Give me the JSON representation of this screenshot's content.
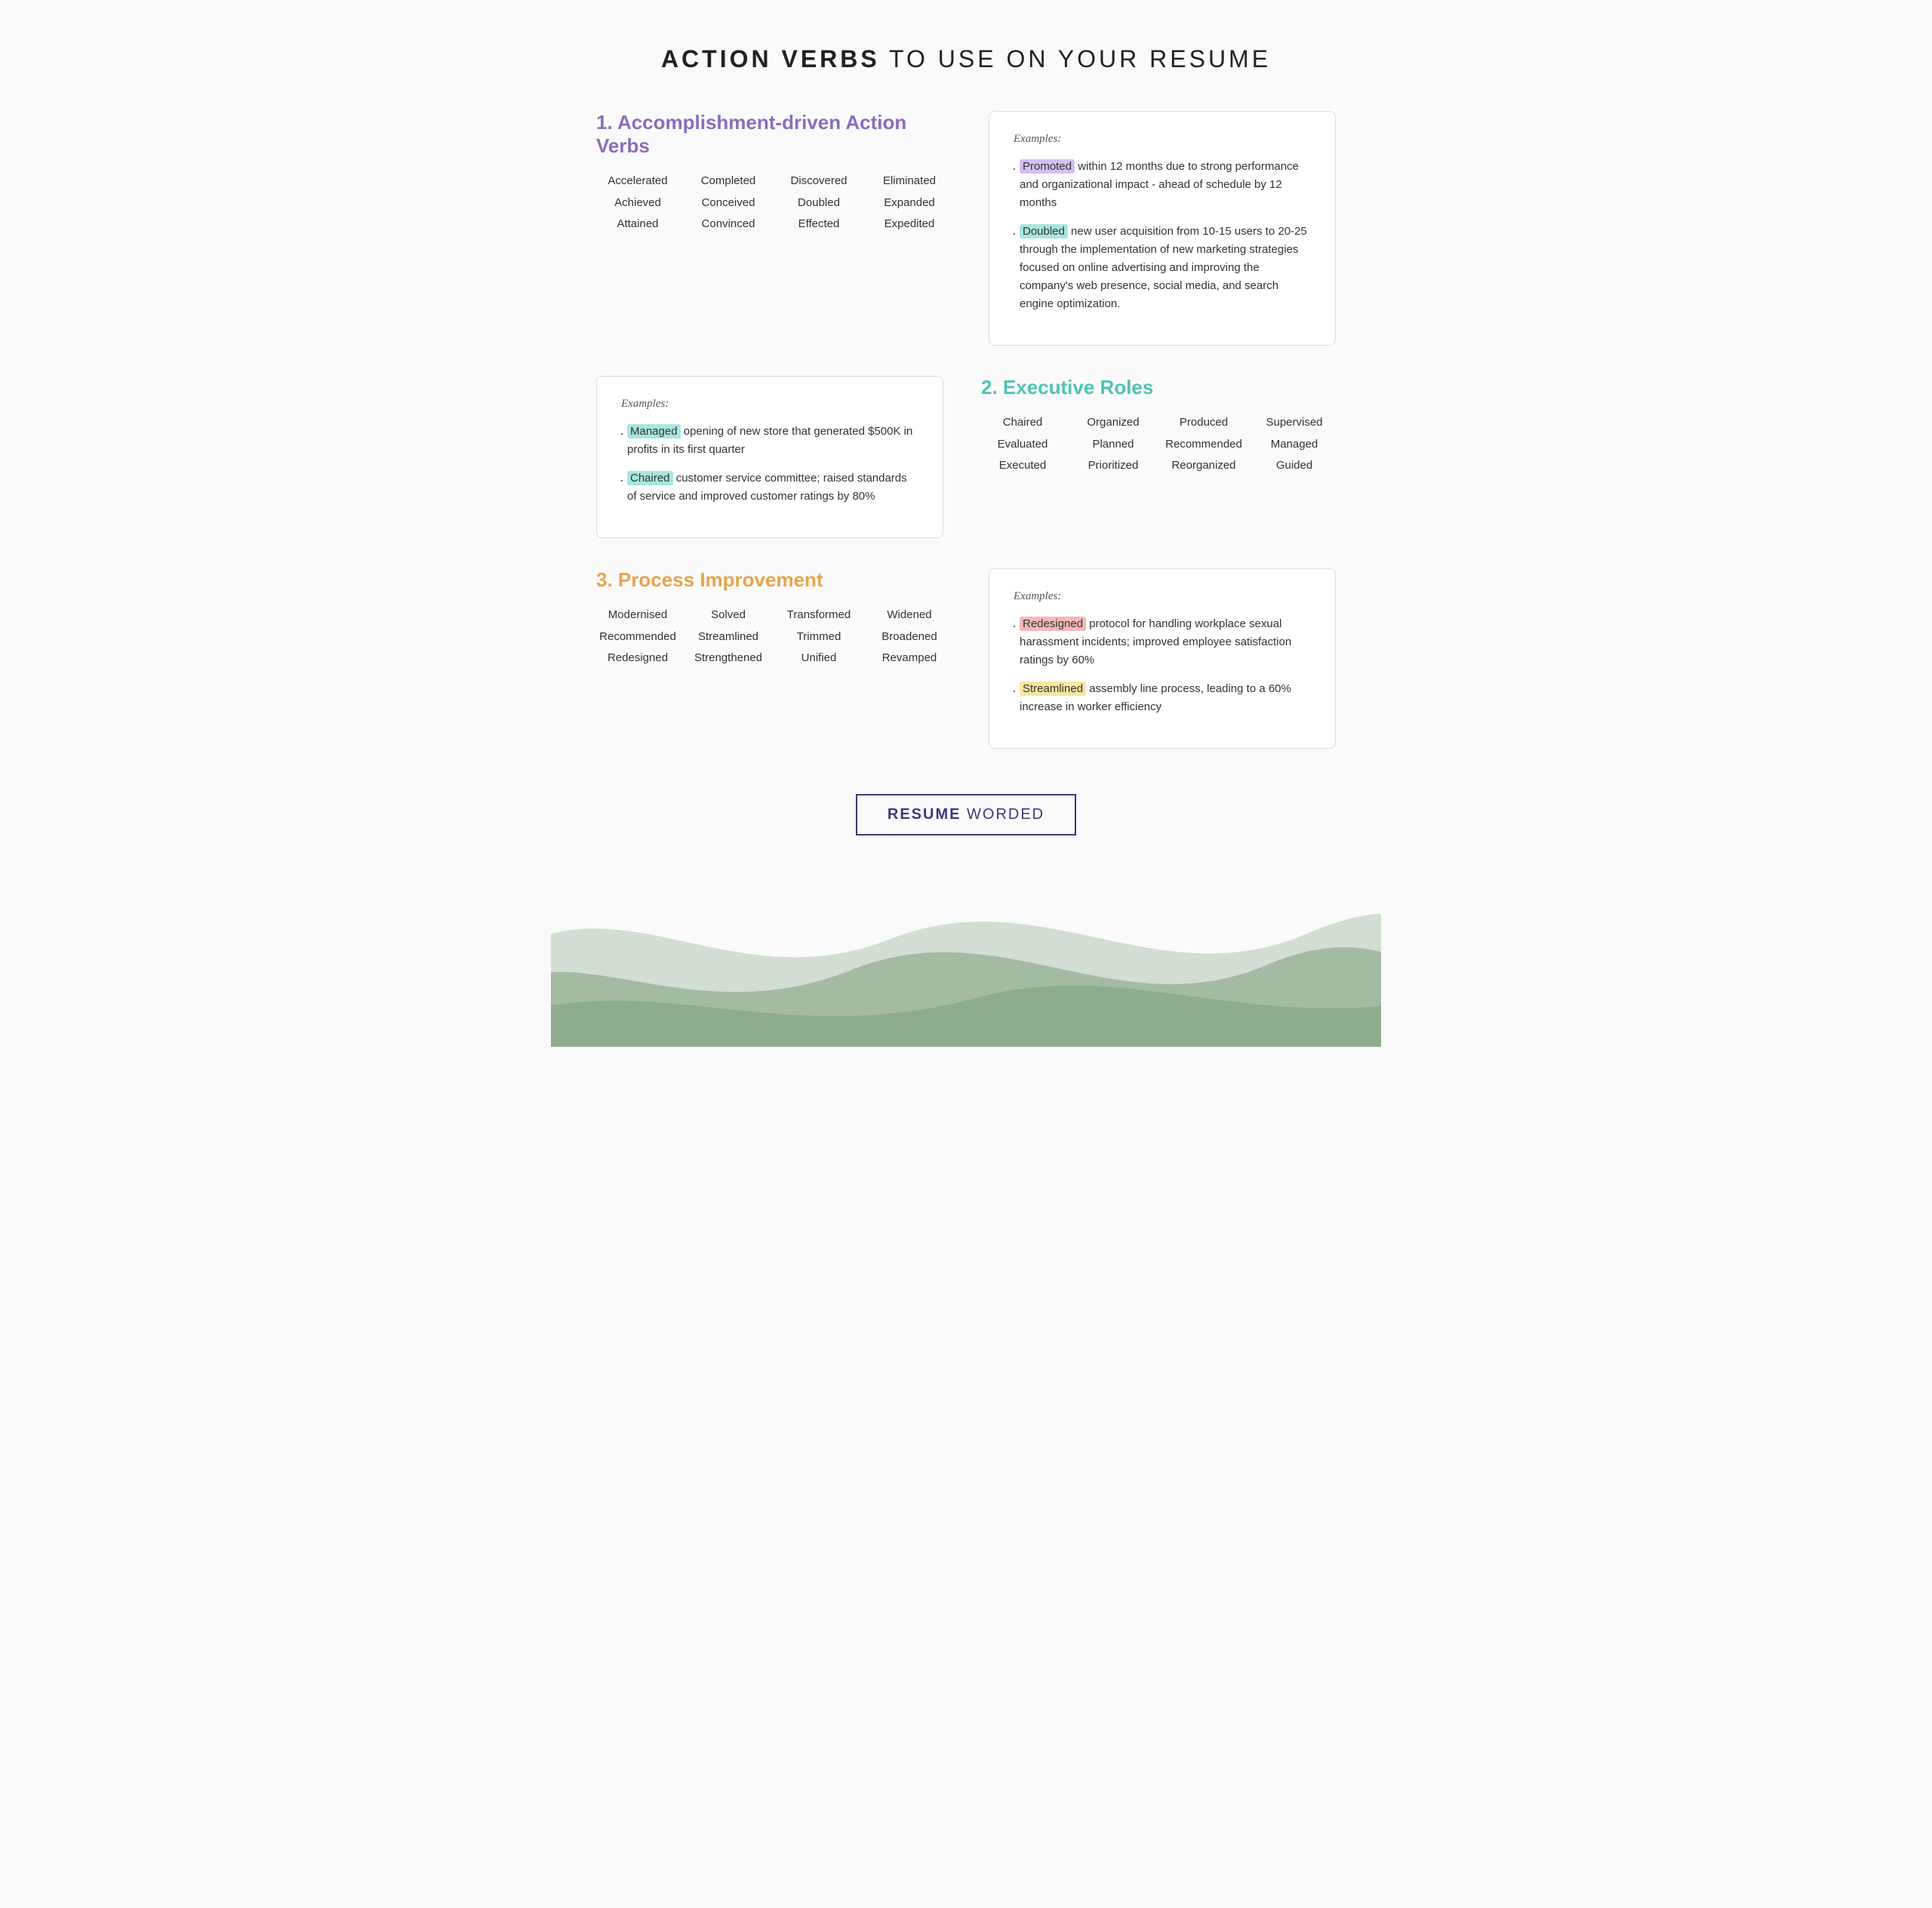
{
  "header": {
    "title_bold": "ACTION VERBS",
    "title_rest": " TO USE ON YOUR RESUME"
  },
  "section1": {
    "title": "1. Accomplishment-driven Action Verbs",
    "words": [
      [
        "Accelerated",
        "Achieved",
        "Attained"
      ],
      [
        "Completed",
        "Conceived",
        "Convinced"
      ],
      [
        "Discovered",
        "Doubled",
        "Effected"
      ],
      [
        "Eliminated",
        "Expanded",
        "Expedited"
      ]
    ],
    "example_label": "Examples:",
    "examples": [
      {
        "highlight": "Promoted",
        "highlight_class": "highlight-purple",
        "text": " within 12 months due to strong performance and organizational impact - ahead of schedule by 12 months"
      },
      {
        "highlight": "Doubled",
        "highlight_class": "highlight-teal",
        "text": " new user acquisition from 10-15 users to 20-25 through the implementation of new marketing strategies focused on online advertising and improving the company's web presence, social media, and search engine optimization."
      }
    ]
  },
  "section1_example2": {
    "label": "Examples:",
    "examples": [
      {
        "highlight": "Managed",
        "highlight_class": "highlight-teal",
        "text": " opening of new store that generated $500K in profits in its first quarter"
      },
      {
        "highlight": "Chaired",
        "highlight_class": "highlight-teal",
        "text": " customer service committee; raised standards of service and improved customer ratings by 80%"
      }
    ]
  },
  "section2": {
    "title": "2. Executive Roles",
    "words": [
      [
        "Chaired",
        "Evaluated",
        "Executed"
      ],
      [
        "Organized",
        "Planned",
        "Prioritized"
      ],
      [
        "Produced",
        "Recommended",
        "Reorganized"
      ],
      [
        "Supervised",
        "Managed",
        "Guided"
      ]
    ]
  },
  "section3": {
    "title": "3. Process Improvement",
    "words": [
      [
        "Modernised",
        "Recommended",
        "Redesigned"
      ],
      [
        "Solved",
        "Streamlined",
        "Strengthened"
      ],
      [
        "Transformed",
        "Trimmed",
        "Unified"
      ],
      [
        "Widened",
        "Broadened",
        "Revamped"
      ]
    ],
    "example_label": "Examples:",
    "examples": [
      {
        "highlight": "Redesigned",
        "highlight_class": "highlight-pink",
        "text": " protocol for handling workplace sexual harassment incidents; improved employee satisfaction ratings by 60%"
      },
      {
        "highlight": "Streamlined",
        "highlight_class": "highlight-yellow",
        "text": " assembly line process, leading to a 60% increase in worker efficiency"
      }
    ]
  },
  "footer": {
    "logo_bold": "RESUME",
    "logo_rest": " WORDED"
  }
}
